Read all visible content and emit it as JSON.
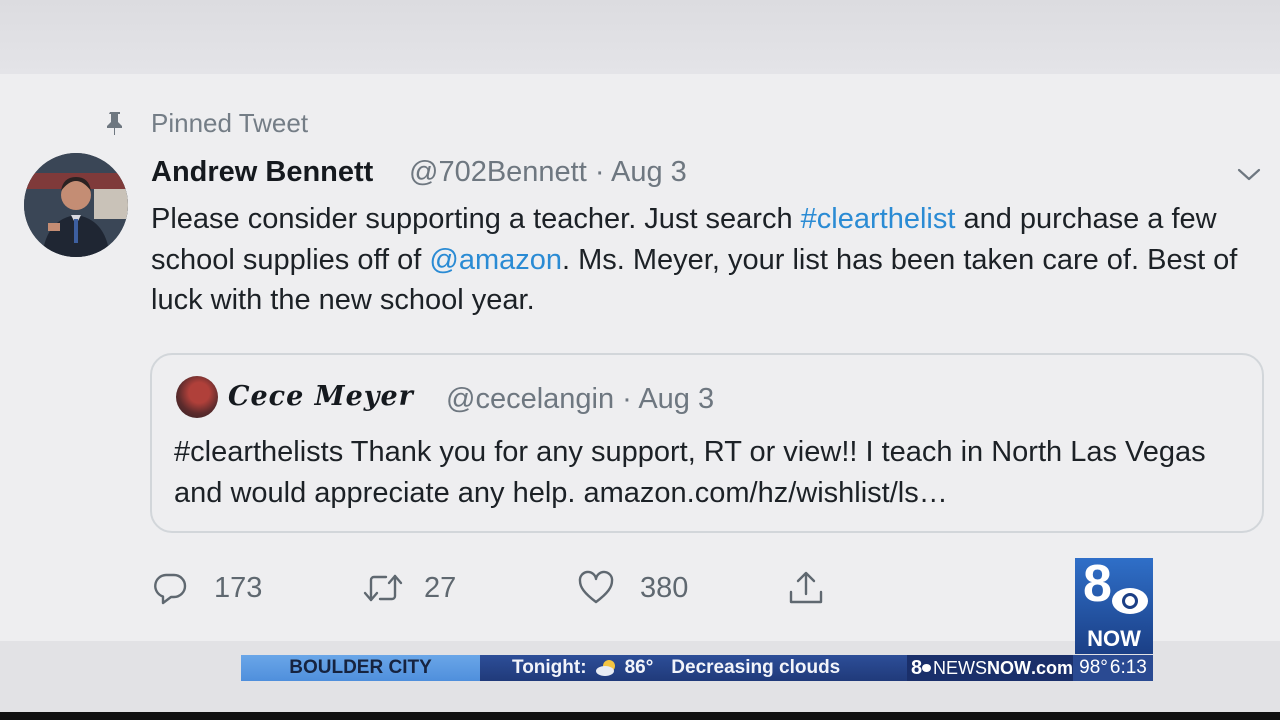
{
  "pinned_label": "Pinned Tweet",
  "tweet": {
    "author_name": "Andrew Bennett",
    "author_handle": "@702Bennett",
    "date_sep": "·",
    "date": "Aug 3",
    "text_1": "Please consider supporting a teacher. Just search ",
    "hashtag": "#clearthelist",
    "text_2": " and purchase a few school supplies off of ",
    "mention": "@amazon",
    "text_3": ".  Ms. Meyer, your list has been taken care of. Best of luck with the new school year."
  },
  "quoted": {
    "name": "Cece Meyer",
    "handle": "@cecelangin",
    "date_sep": "·",
    "date": "Aug 3",
    "text": "#clearthelists Thank you for any support, RT or view!!  I teach in North Las Vegas and would appreciate any help.  amazon.com/hz/wishlist/ls…"
  },
  "actions": {
    "replies": "173",
    "retweets": "27",
    "likes": "380"
  },
  "ticker": {
    "city": "BOULDER CITY",
    "tonight_label": "Tonight:",
    "temp": "86°",
    "forecast": "Decreasing clouds",
    "site_prefix": "8",
    "site_news": "NEWS",
    "site_now": "NOW",
    "site_suffix": ".com",
    "current_temp": "98°",
    "time": "6:13"
  },
  "logo": {
    "number": "8",
    "label": "NOW"
  },
  "colors": {
    "link": "#2a8bd4",
    "ticker_city_bg": "#5b98e0",
    "ticker_bg": "#203a7a"
  },
  "icons": [
    "pin-icon",
    "chevron-down-icon",
    "reply-icon",
    "retweet-icon",
    "like-icon",
    "share-icon",
    "partly-cloudy-icon",
    "cbs-eye-icon"
  ]
}
